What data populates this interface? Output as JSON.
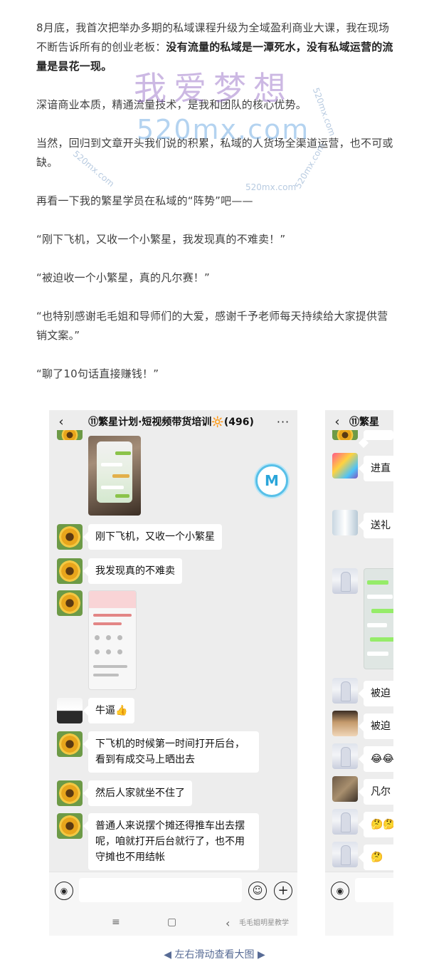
{
  "article": {
    "p1_normal": "8月底，我首次把举办多期的私域课程升级为全域盈利商业大课，我在现场不断告诉所有的创业老板：",
    "p1_bold": "没有流量的私域是一潭死水，没有私域运营的流量是昙花一现。",
    "p2": "深谙商业本质，精通流量技术，是我和团队的核心优势。",
    "p3": "当然，回归到文章开头我们说的积累，私域的人货场全渠道运营，也不可或缺。",
    "p4": "再看一下我的繁星学员在私域的“阵势”吧——",
    "q1": "“刚下飞机，又收一个小繁星，我发现真的不难卖！”",
    "q2": "“被迫收一个小繁星，真的凡尔赛！”",
    "q3": "“也特别感谢毛毛姐和导师们的大爱，感谢千予老师每天持续给大家提供营销文案。”",
    "q4": "“聊了10句话直接赚钱！”"
  },
  "watermark": {
    "big": "我爱梦想",
    "url": "520mx.com",
    "small": "520mx.com"
  },
  "phone1": {
    "back_icon": "‹",
    "title": "⑪繁星计划·短视频带货培训🔆(496)",
    "more_icon": "···",
    "floating_logo": "M",
    "messages": [
      "刚下飞机，又收一个小繁星",
      "我发现真的不难卖",
      "牛逼👍",
      "下飞机的时候第一时间打开后台，看到有成交马上晒出去",
      "然后人家就坐不住了",
      "普通人来说摆个摊还得推车出去摆呢，咱就打开后台就行了，也不用守摊也不用结帐"
    ],
    "msg6_lines": [
      "普通人来说摆个摊还得推车出去摆",
      "呢，咱就打开后台就行了，也不用",
      "守摊也不用结帐"
    ],
    "msg4_lines": [
      "下飞机的时候第一时间打开后台，",
      "看到有成交马上晒出去"
    ],
    "nav": {
      "menu": "≡",
      "home": "▢",
      "back": "‹"
    },
    "credit": "毛毛姐明星教学"
  },
  "phone2": {
    "back_icon": "‹",
    "title": "⑪繁星",
    "messages": [
      "进直",
      "送礼",
      "被迫",
      "被迫",
      "😂😂",
      "凡尔",
      "🤔🤔",
      "🤔"
    ]
  },
  "caption": "◀ 左右滑动查看大图 ▶"
}
